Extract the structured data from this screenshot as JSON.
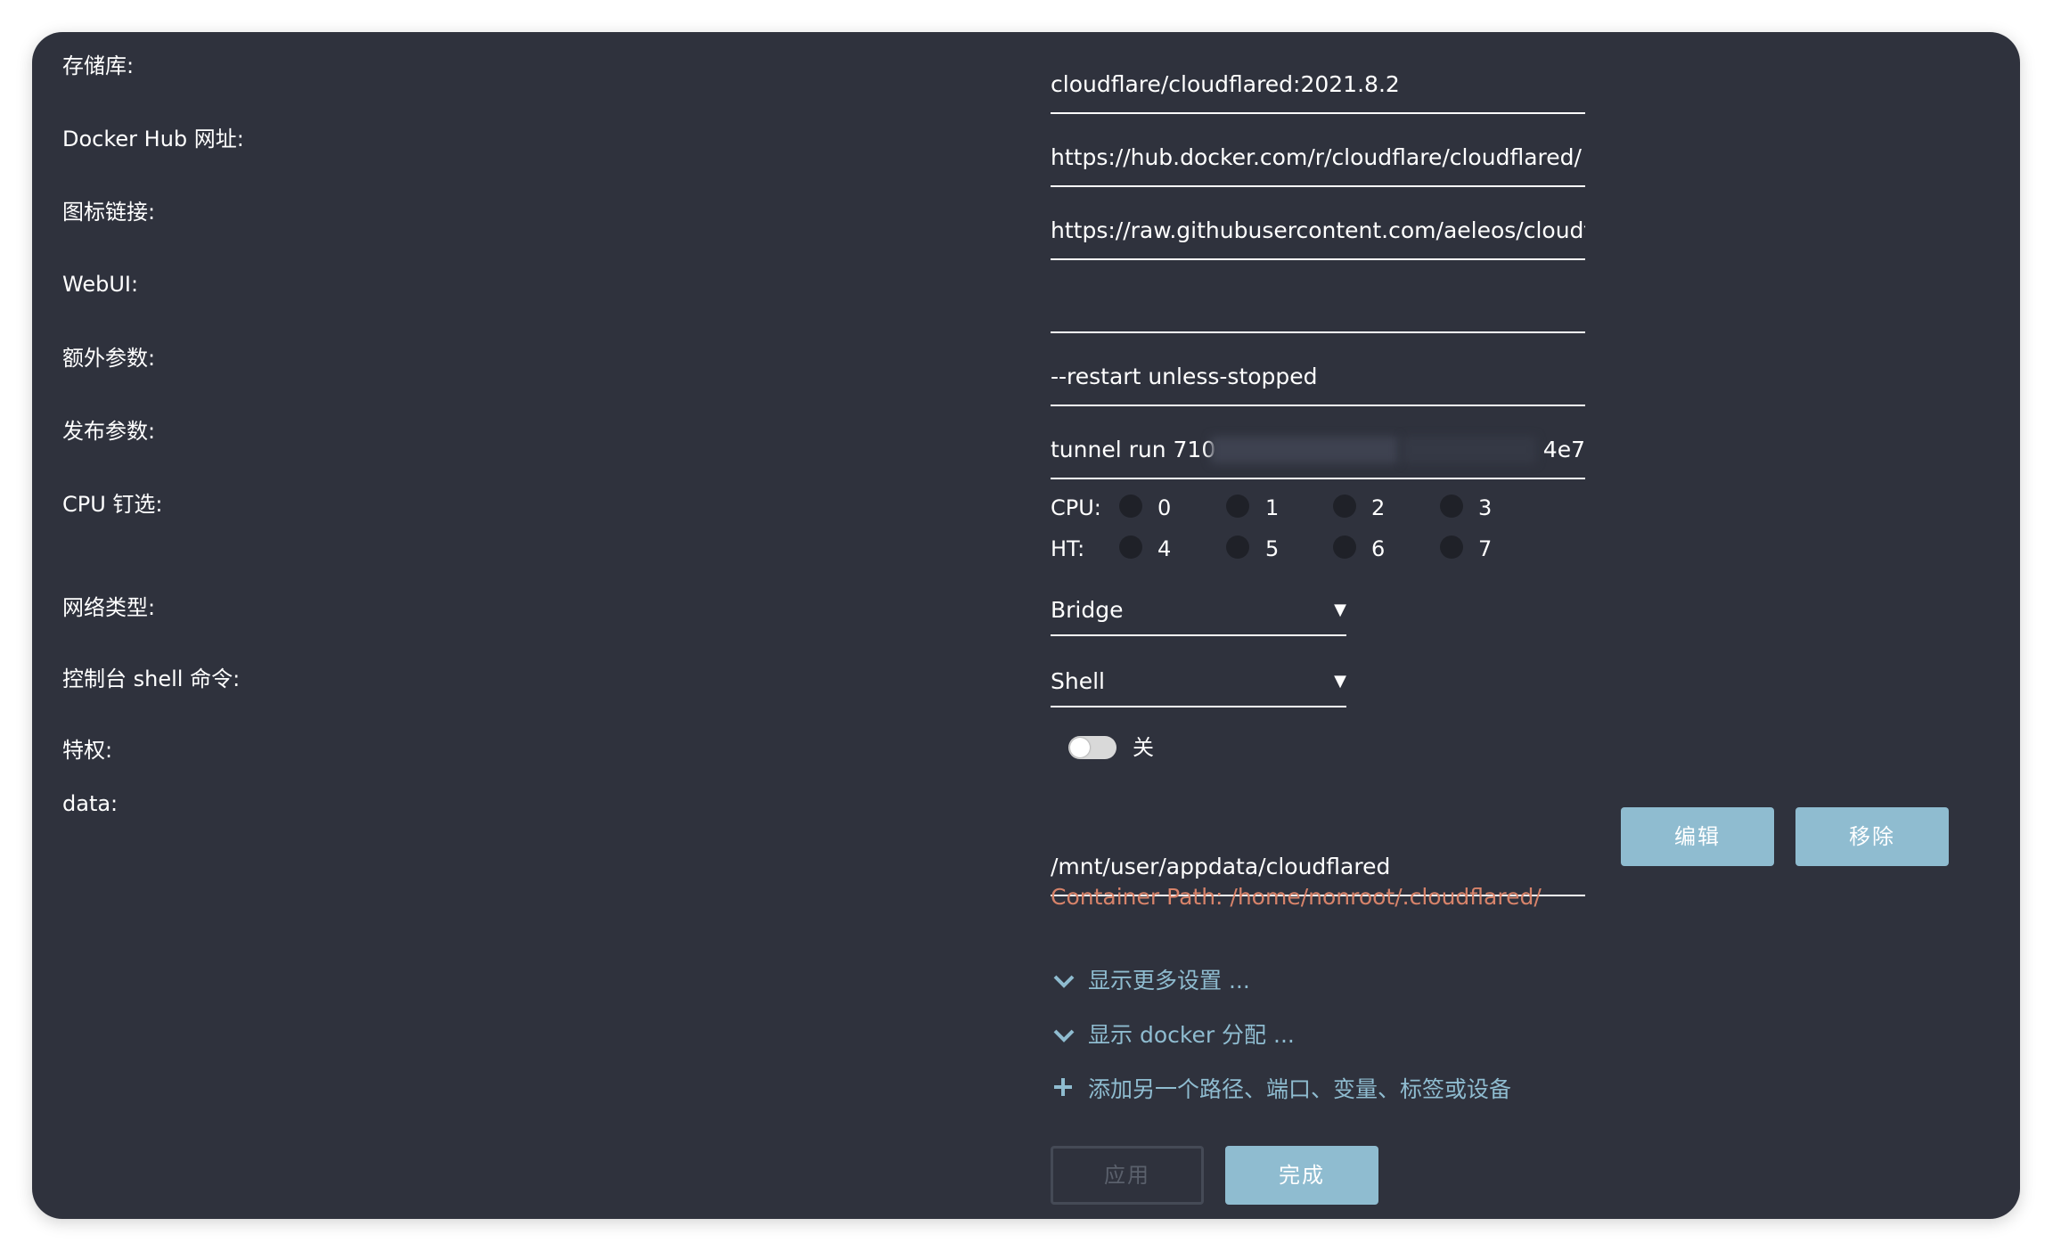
{
  "labels": {
    "repository": "存储库:",
    "docker_hub_url": "Docker Hub 网址:",
    "icon_url": "图标链接:",
    "webui": "WebUI:",
    "extra_params": "额外参数:",
    "post_args": "发布参数:",
    "cpu_pinning": "CPU 钉选:",
    "network_type": "网络类型:",
    "console_shell": "控制台 shell 命令:",
    "privileged": "特权:",
    "data": "data:"
  },
  "values": {
    "repository": "cloudflare/cloudflared:2021.8.2",
    "docker_hub_url": "https://hub.docker.com/r/cloudflare/cloudflared/",
    "icon_url": "https://raw.githubusercontent.com/aeleos/cloudflared",
    "webui": "",
    "extra_params": "--restart unless-stopped",
    "post_args_start": "tunnel run 710",
    "post_args_end": "4e7"
  },
  "cpu": {
    "cpu_label": "CPU:",
    "ht_label": "HT:",
    "cpu_cores": [
      "0",
      "1",
      "2",
      "3"
    ],
    "ht_cores": [
      "4",
      "5",
      "6",
      "7"
    ]
  },
  "network": {
    "selected": "Bridge"
  },
  "shell": {
    "selected": "Shell"
  },
  "privileged": {
    "state_label": "关",
    "on": false
  },
  "data_path": {
    "host_path": "/mnt/user/appdata/cloudflared",
    "container_path": "Container Path: /home/nonroot/.cloudflared/",
    "edit_label": "编辑",
    "remove_label": "移除"
  },
  "links": {
    "more_settings": "显示更多设置 ...",
    "docker_alloc": "显示 docker 分配 ...",
    "add_another": "添加另一个路径、端口、变量、标签或设备"
  },
  "buttons": {
    "apply": "应用",
    "done": "完成"
  },
  "colors": {
    "background": "#2f323d",
    "accent": "#8fbcd0",
    "container_path": "#d7836a"
  },
  "icons": {
    "expand": "chevron-down-icon",
    "add": "plus-icon",
    "dropdown": "caret-down-icon"
  }
}
